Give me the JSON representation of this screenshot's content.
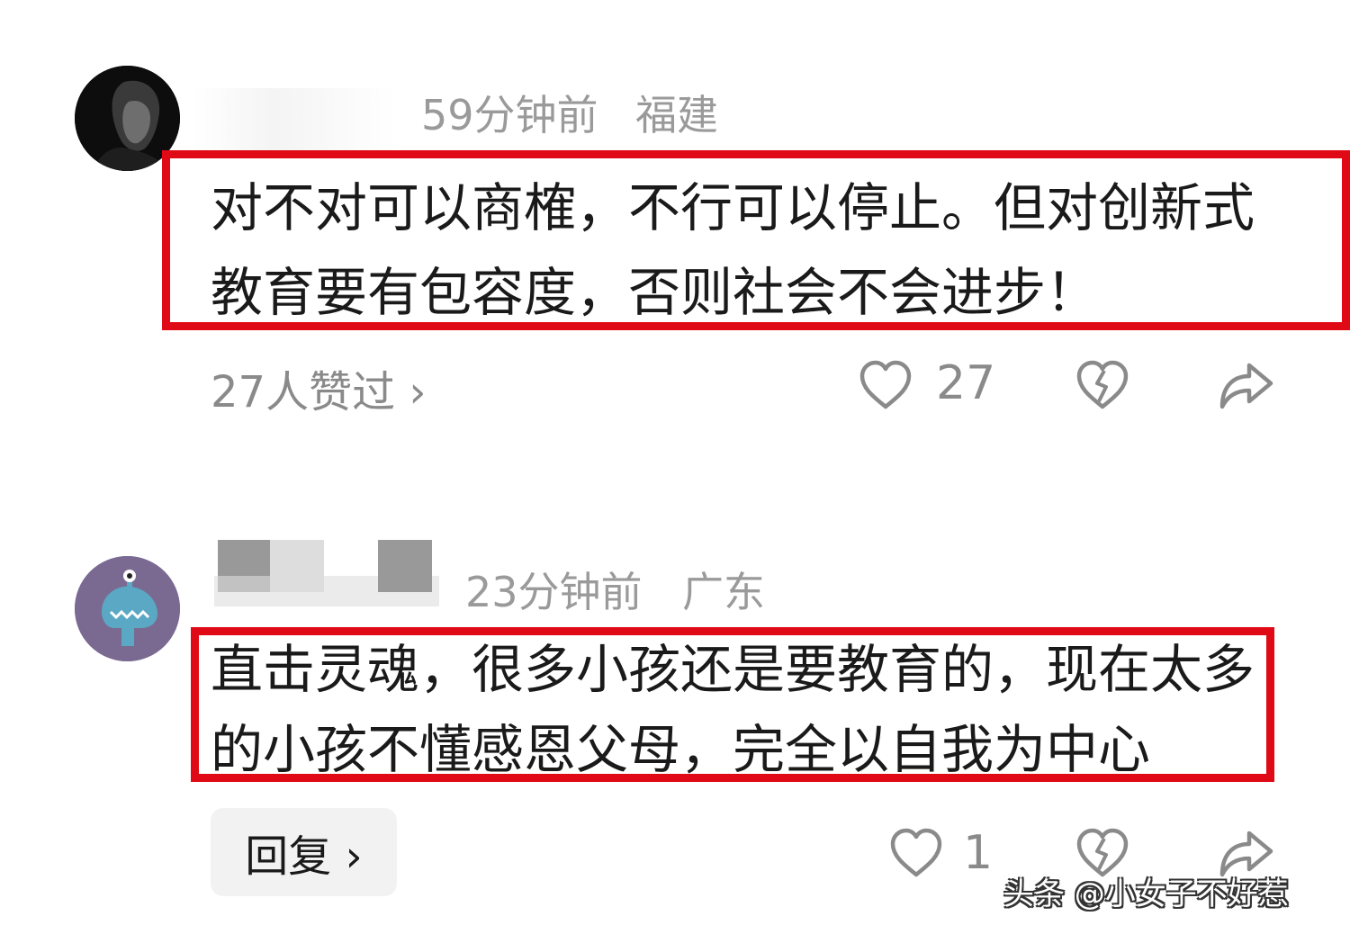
{
  "comments": [
    {
      "time": "59分钟前",
      "location": "福建",
      "text_lines": [
        "对不对可以商榷，不行可以停止。但对创新式",
        "教育要有包容度，否则社会不会进步！"
      ],
      "likes_summary": "27人赞过 ›",
      "like_count": "27"
    },
    {
      "time": "23分钟前",
      "location": "广东",
      "text_lines": [
        "直击灵魂，很多小孩还是要教育的，现在太多",
        "的小孩不懂感恩父母，完全以自我为中心"
      ],
      "reply_label": "回复 ›",
      "like_count": "1"
    }
  ],
  "watermark": "头条 @小女子不好惹",
  "colors": {
    "highlight": "#e00a16",
    "meta": "#9a9a9a",
    "icon": "#8a8a8a"
  },
  "icons": [
    "heart-icon",
    "broken-heart-icon",
    "share-icon"
  ]
}
